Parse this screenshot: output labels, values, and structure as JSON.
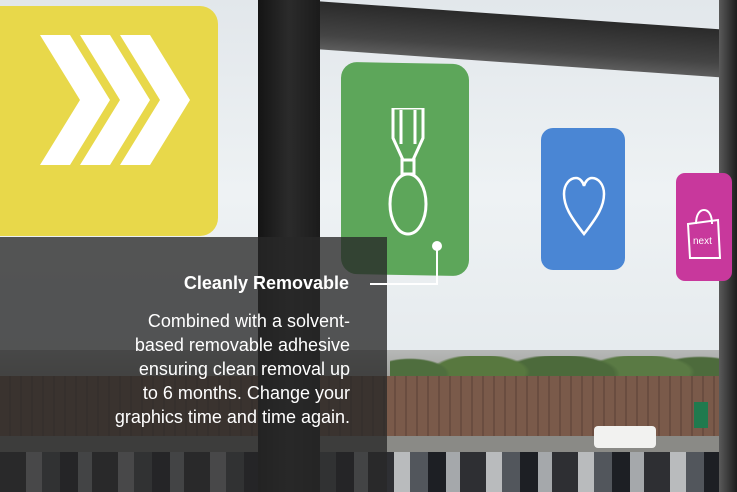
{
  "callout": {
    "title": "Cleanly Removable",
    "body_lines": [
      "Combined with a solvent-",
      "based removable adhesive",
      "ensuring clean removal up",
      "to 6 months. Change your",
      "graphics time and time again."
    ]
  },
  "decals": {
    "yellow": {
      "icon": "double-chevron-arrow-icon",
      "color": "#e8d84a"
    },
    "green": {
      "icon": "medal-icon",
      "color": "#5da65a"
    },
    "blue": {
      "icon": "heart-icon",
      "color": "#4a86d4"
    },
    "pink": {
      "icon": "shopping-bag-icon",
      "label": "next",
      "color": "#c8389c"
    }
  },
  "colors": {
    "panel": "rgba(40,40,40,0.78)",
    "text": "#ffffff"
  }
}
